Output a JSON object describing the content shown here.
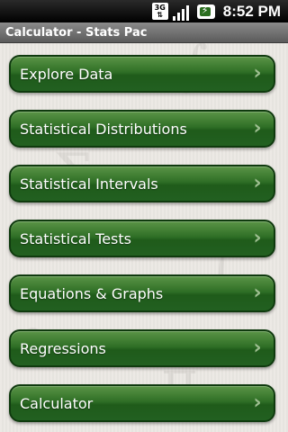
{
  "status_bar": {
    "network": "3G",
    "time": "8:52 PM"
  },
  "app": {
    "title": "Calculator - Stats Pac"
  },
  "menu": {
    "items": [
      {
        "label": "Explore Data"
      },
      {
        "label": "Statistical Distributions"
      },
      {
        "label": "Statistical Intervals"
      },
      {
        "label": "Statistical Tests"
      },
      {
        "label": "Equations & Graphs"
      },
      {
        "label": "Regressions"
      },
      {
        "label": "Calculator"
      }
    ]
  },
  "icons": {
    "chevron": "chevron-right-icon",
    "signal": "signal-icon",
    "battery": "battery-charging-icon",
    "network": "3g-data-icon"
  },
  "colors": {
    "button_green": "#2f6f26",
    "button_border": "#0f3a0e",
    "title_bar": "#6e6e6e",
    "status_bar": "#000000"
  }
}
